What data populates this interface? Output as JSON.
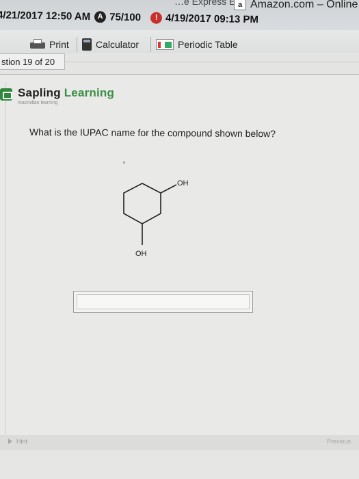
{
  "browser": {
    "tab_express": "…e Express E…",
    "tab_amazon": "Amazon.com – Online",
    "amazon_icon": "a"
  },
  "status_strip": {
    "date_left": "4/21/2017 12:50 AM",
    "badge_a": "A",
    "score": "75/100",
    "badge_red": "!",
    "date_right": "4/19/2017 09:13 PM"
  },
  "toolbar": {
    "print_label": "Print",
    "calculator_label": "Calculator",
    "periodic_label": "Periodic Table"
  },
  "question_counter": "stion 19 of 20",
  "logo": {
    "brand_part1": "Sapling ",
    "brand_part2": "Learning",
    "tagline": "macmillan learning"
  },
  "question": {
    "text": "What is the IUPAC name for the compound shown below?",
    "molecule_labels": [
      "OH",
      "OH"
    ]
  },
  "answer": {
    "value": "",
    "placeholder": ""
  },
  "footer": {
    "hint_label": "Hint",
    "nav_label": "Previous"
  },
  "colors": {
    "brand_green": "#3a8f47",
    "badge_red": "#c9302c"
  }
}
